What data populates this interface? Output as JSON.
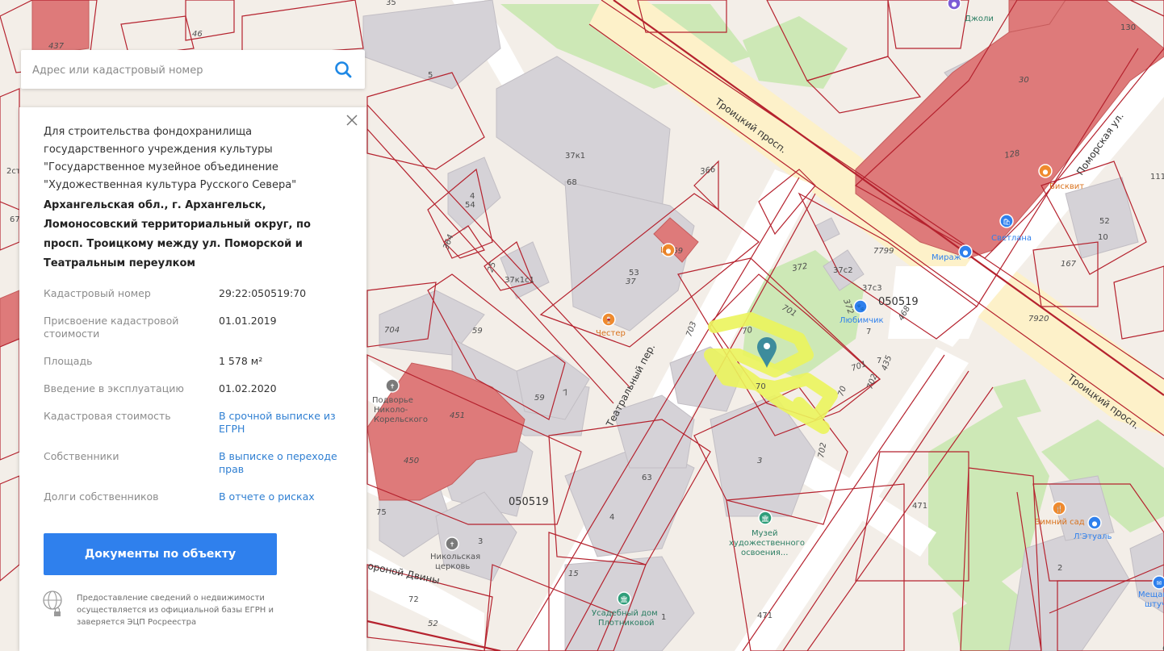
{
  "search": {
    "placeholder": "Адрес или кадастровый номер"
  },
  "info": {
    "purpose": "Для строительства фондохранилища государственного учреждения культуры \"Государственное музейное объединение \"Художественная культура Русского Севера\"",
    "address": "Архангельская обл., г. Архангельск, Ломоносовский территориальный округ, по просп. Троицкому между ул. Поморской и Театральным переулком",
    "rows": [
      {
        "label": "Кадастровый номер",
        "value": "29:22:050519:70"
      },
      {
        "label": "Присвоение кадастровой стоимости",
        "value": "01.01.2019"
      },
      {
        "label": "Площадь",
        "value": "1 578 м²"
      },
      {
        "label": "Введение в эксплуатацию",
        "value": "01.02.2020"
      },
      {
        "label": "Кадастровая стоимость",
        "value": "В срочной выписке из ЕГРН"
      },
      {
        "label": "Собственники",
        "value": "В выписке о переходе прав"
      },
      {
        "label": "Долги собственников",
        "value": "В отчете о рисках"
      }
    ],
    "button": "Документы по объекту",
    "disclaimer": "Предоставление сведений о недвижимости осуществляется из официальной базы ЕГРН и заверяется ЭЦП Росреестра"
  },
  "map": {
    "streets": [
      "Троицкий просп.",
      "Поморская ул.",
      "Театральный пер.",
      "Троицкий просп.",
      "ороной Двины"
    ],
    "quarters": [
      "050519",
      "050519"
    ],
    "pois": [
      "Джоли",
      "Честер",
      "Подворье Николо-Корельского",
      "Никольская церковь",
      "Любимчик",
      "Светлана",
      "Мираж",
      "Бисквит",
      "Музей художественного освоения...",
      "Усадебный дом Плотниковой",
      "Зимний сад",
      "Л'Этуаль",
      "Мещанские штучки",
      "Ц"
    ],
    "labels": [
      "437",
      "46",
      "5",
      "35",
      "130",
      "30",
      "128",
      "2ст",
      "67",
      "37к1",
      "68",
      "366",
      "4",
      "54",
      "364",
      "25",
      "37к1с1",
      "53",
      "37",
      "459",
      "372",
      "7799",
      "37с2",
      "37с3",
      "372",
      "468",
      "7",
      "52",
      "10",
      "167",
      "111",
      "701",
      "703",
      "70",
      "70",
      "701",
      "702",
      "435",
      "7",
      "70",
      "702",
      "704",
      "59",
      "59",
      "7",
      "451",
      "450",
      "3",
      "63",
      "4",
      "75",
      "3",
      "72",
      "15",
      "1",
      "471",
      "471",
      "2",
      "52",
      "7920",
      "6"
    ],
    "colors": {
      "parcel": "#b5222e",
      "building_red": "#de7a7a",
      "building_grey": "#d5d2d7",
      "green": "#cde8b6",
      "road": "#ffffff",
      "main_road": "#fdf1c9",
      "highlight": "#ecf55d",
      "marker": "#3d8c9c"
    }
  }
}
